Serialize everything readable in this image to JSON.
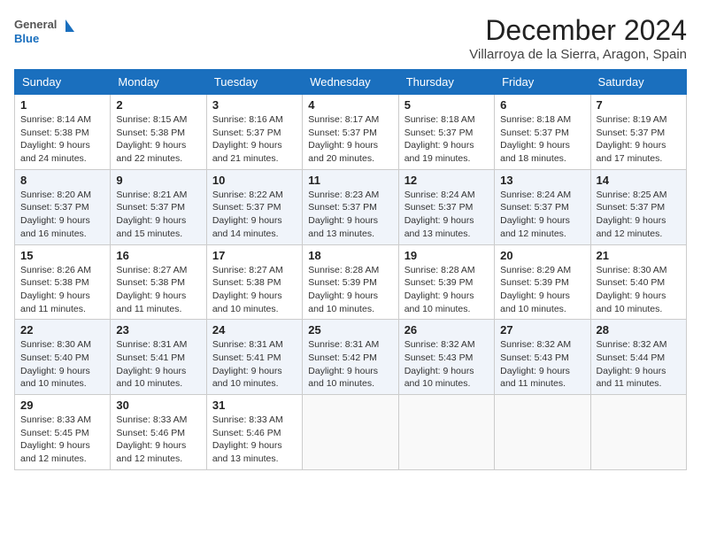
{
  "logo": {
    "line1": "General",
    "line2": "Blue"
  },
  "title": "December 2024",
  "location": "Villarroya de la Sierra, Aragon, Spain",
  "days_of_week": [
    "Sunday",
    "Monday",
    "Tuesday",
    "Wednesday",
    "Thursday",
    "Friday",
    "Saturday"
  ],
  "weeks": [
    [
      {
        "day": "1",
        "sunrise": "8:14 AM",
        "sunset": "5:38 PM",
        "daylight": "9 hours and 24 minutes."
      },
      {
        "day": "2",
        "sunrise": "8:15 AM",
        "sunset": "5:38 PM",
        "daylight": "9 hours and 22 minutes."
      },
      {
        "day": "3",
        "sunrise": "8:16 AM",
        "sunset": "5:37 PM",
        "daylight": "9 hours and 21 minutes."
      },
      {
        "day": "4",
        "sunrise": "8:17 AM",
        "sunset": "5:37 PM",
        "daylight": "9 hours and 20 minutes."
      },
      {
        "day": "5",
        "sunrise": "8:18 AM",
        "sunset": "5:37 PM",
        "daylight": "9 hours and 19 minutes."
      },
      {
        "day": "6",
        "sunrise": "8:18 AM",
        "sunset": "5:37 PM",
        "daylight": "9 hours and 18 minutes."
      },
      {
        "day": "7",
        "sunrise": "8:19 AM",
        "sunset": "5:37 PM",
        "daylight": "9 hours and 17 minutes."
      }
    ],
    [
      {
        "day": "8",
        "sunrise": "8:20 AM",
        "sunset": "5:37 PM",
        "daylight": "9 hours and 16 minutes."
      },
      {
        "day": "9",
        "sunrise": "8:21 AM",
        "sunset": "5:37 PM",
        "daylight": "9 hours and 15 minutes."
      },
      {
        "day": "10",
        "sunrise": "8:22 AM",
        "sunset": "5:37 PM",
        "daylight": "9 hours and 14 minutes."
      },
      {
        "day": "11",
        "sunrise": "8:23 AM",
        "sunset": "5:37 PM",
        "daylight": "9 hours and 13 minutes."
      },
      {
        "day": "12",
        "sunrise": "8:24 AM",
        "sunset": "5:37 PM",
        "daylight": "9 hours and 13 minutes."
      },
      {
        "day": "13",
        "sunrise": "8:24 AM",
        "sunset": "5:37 PM",
        "daylight": "9 hours and 12 minutes."
      },
      {
        "day": "14",
        "sunrise": "8:25 AM",
        "sunset": "5:37 PM",
        "daylight": "9 hours and 12 minutes."
      }
    ],
    [
      {
        "day": "15",
        "sunrise": "8:26 AM",
        "sunset": "5:38 PM",
        "daylight": "9 hours and 11 minutes."
      },
      {
        "day": "16",
        "sunrise": "8:27 AM",
        "sunset": "5:38 PM",
        "daylight": "9 hours and 11 minutes."
      },
      {
        "day": "17",
        "sunrise": "8:27 AM",
        "sunset": "5:38 PM",
        "daylight": "9 hours and 10 minutes."
      },
      {
        "day": "18",
        "sunrise": "8:28 AM",
        "sunset": "5:39 PM",
        "daylight": "9 hours and 10 minutes."
      },
      {
        "day": "19",
        "sunrise": "8:28 AM",
        "sunset": "5:39 PM",
        "daylight": "9 hours and 10 minutes."
      },
      {
        "day": "20",
        "sunrise": "8:29 AM",
        "sunset": "5:39 PM",
        "daylight": "9 hours and 10 minutes."
      },
      {
        "day": "21",
        "sunrise": "8:30 AM",
        "sunset": "5:40 PM",
        "daylight": "9 hours and 10 minutes."
      }
    ],
    [
      {
        "day": "22",
        "sunrise": "8:30 AM",
        "sunset": "5:40 PM",
        "daylight": "9 hours and 10 minutes."
      },
      {
        "day": "23",
        "sunrise": "8:31 AM",
        "sunset": "5:41 PM",
        "daylight": "9 hours and 10 minutes."
      },
      {
        "day": "24",
        "sunrise": "8:31 AM",
        "sunset": "5:41 PM",
        "daylight": "9 hours and 10 minutes."
      },
      {
        "day": "25",
        "sunrise": "8:31 AM",
        "sunset": "5:42 PM",
        "daylight": "9 hours and 10 minutes."
      },
      {
        "day": "26",
        "sunrise": "8:32 AM",
        "sunset": "5:43 PM",
        "daylight": "9 hours and 10 minutes."
      },
      {
        "day": "27",
        "sunrise": "8:32 AM",
        "sunset": "5:43 PM",
        "daylight": "9 hours and 11 minutes."
      },
      {
        "day": "28",
        "sunrise": "8:32 AM",
        "sunset": "5:44 PM",
        "daylight": "9 hours and 11 minutes."
      }
    ],
    [
      {
        "day": "29",
        "sunrise": "8:33 AM",
        "sunset": "5:45 PM",
        "daylight": "9 hours and 12 minutes."
      },
      {
        "day": "30",
        "sunrise": "8:33 AM",
        "sunset": "5:46 PM",
        "daylight": "9 hours and 12 minutes."
      },
      {
        "day": "31",
        "sunrise": "8:33 AM",
        "sunset": "5:46 PM",
        "daylight": "9 hours and 13 minutes."
      },
      null,
      null,
      null,
      null
    ]
  ]
}
